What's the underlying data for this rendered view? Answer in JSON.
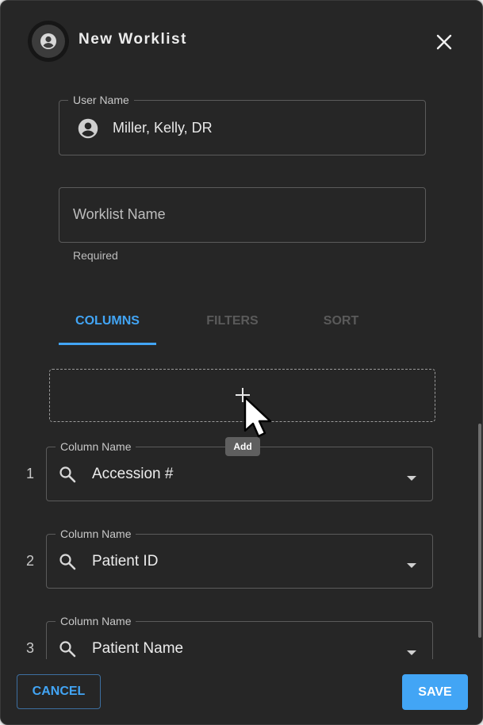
{
  "dialog": {
    "title": "New Worklist",
    "header_icon": "account-circle-icon",
    "close_icon": "close-icon"
  },
  "user_field": {
    "label": "User Name",
    "value": "Miller, Kelly, DR",
    "icon": "account-circle-icon"
  },
  "worklist_field": {
    "placeholder": "Worklist Name",
    "helper": "Required"
  },
  "tabs": [
    {
      "label": "COLUMNS",
      "active": true
    },
    {
      "label": "FILTERS",
      "active": false
    },
    {
      "label": "SORT",
      "active": false
    }
  ],
  "add_zone": {
    "icon": "plus-icon",
    "tooltip": "Add"
  },
  "columns": [
    {
      "number": "1",
      "label": "Column Name",
      "value": "Accession #"
    },
    {
      "number": "2",
      "label": "Column Name",
      "value": "Patient ID"
    },
    {
      "number": "3",
      "label": "Column Name",
      "value": "Patient Name"
    }
  ],
  "footer": {
    "cancel_label": "CANCEL",
    "save_label": "SAVE"
  },
  "colors": {
    "background": "#262626",
    "accent": "#42a5f5",
    "border": "#5b5b5b"
  }
}
